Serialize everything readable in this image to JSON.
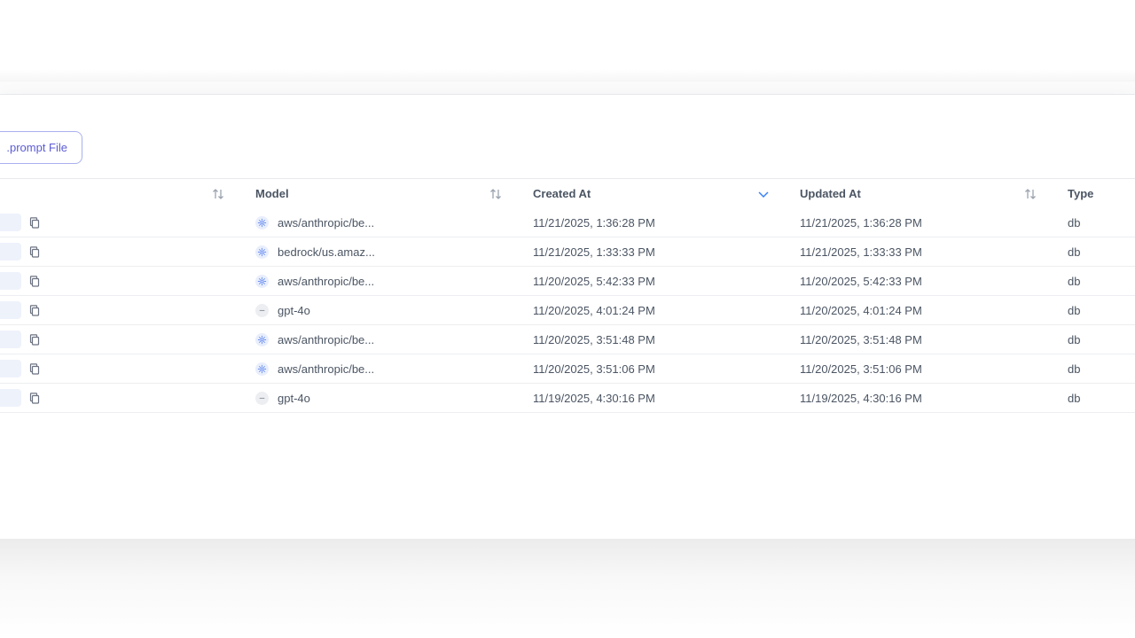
{
  "toolbar": {
    "prompt_button_label": ".prompt File"
  },
  "table": {
    "columns": {
      "model": "Model",
      "created_at": "Created At",
      "updated_at": "Updated At",
      "type": "Type"
    },
    "sorted_column": "created_at",
    "sort_direction": "descending",
    "rows": [
      {
        "model": "aws/anthropic/be...",
        "model_icon": "aws-bedrock-icon",
        "created_at": "11/21/2025, 1:36:28 PM",
        "updated_at": "11/21/2025, 1:36:28 PM",
        "type": "db"
      },
      {
        "model": "bedrock/us.amaz...",
        "model_icon": "aws-bedrock-icon",
        "created_at": "11/21/2025, 1:33:33 PM",
        "updated_at": "11/21/2025, 1:33:33 PM",
        "type": "db"
      },
      {
        "model": "aws/anthropic/be...",
        "model_icon": "aws-bedrock-icon",
        "created_at": "11/20/2025, 5:42:33 PM",
        "updated_at": "11/20/2025, 5:42:33 PM",
        "type": "db"
      },
      {
        "model": "gpt-4o",
        "model_icon": "dash-icon",
        "created_at": "11/20/2025, 4:01:24 PM",
        "updated_at": "11/20/2025, 4:01:24 PM",
        "type": "db"
      },
      {
        "model": "aws/anthropic/be...",
        "model_icon": "aws-bedrock-icon",
        "created_at": "11/20/2025, 3:51:48 PM",
        "updated_at": "11/20/2025, 3:51:48 PM",
        "type": "db"
      },
      {
        "model": "aws/anthropic/be...",
        "model_icon": "aws-bedrock-icon",
        "created_at": "11/20/2025, 3:51:06 PM",
        "updated_at": "11/20/2025, 3:51:06 PM",
        "type": "db"
      },
      {
        "model": "gpt-4o",
        "model_icon": "dash-icon",
        "created_at": "11/19/2025, 4:30:16 PM",
        "updated_at": "11/19/2025, 4:30:16 PM",
        "type": "db"
      }
    ]
  },
  "colors": {
    "accent": "#5b5bd6",
    "sort_active": "#3b82f6",
    "sort_inactive": "#9ca3af"
  }
}
